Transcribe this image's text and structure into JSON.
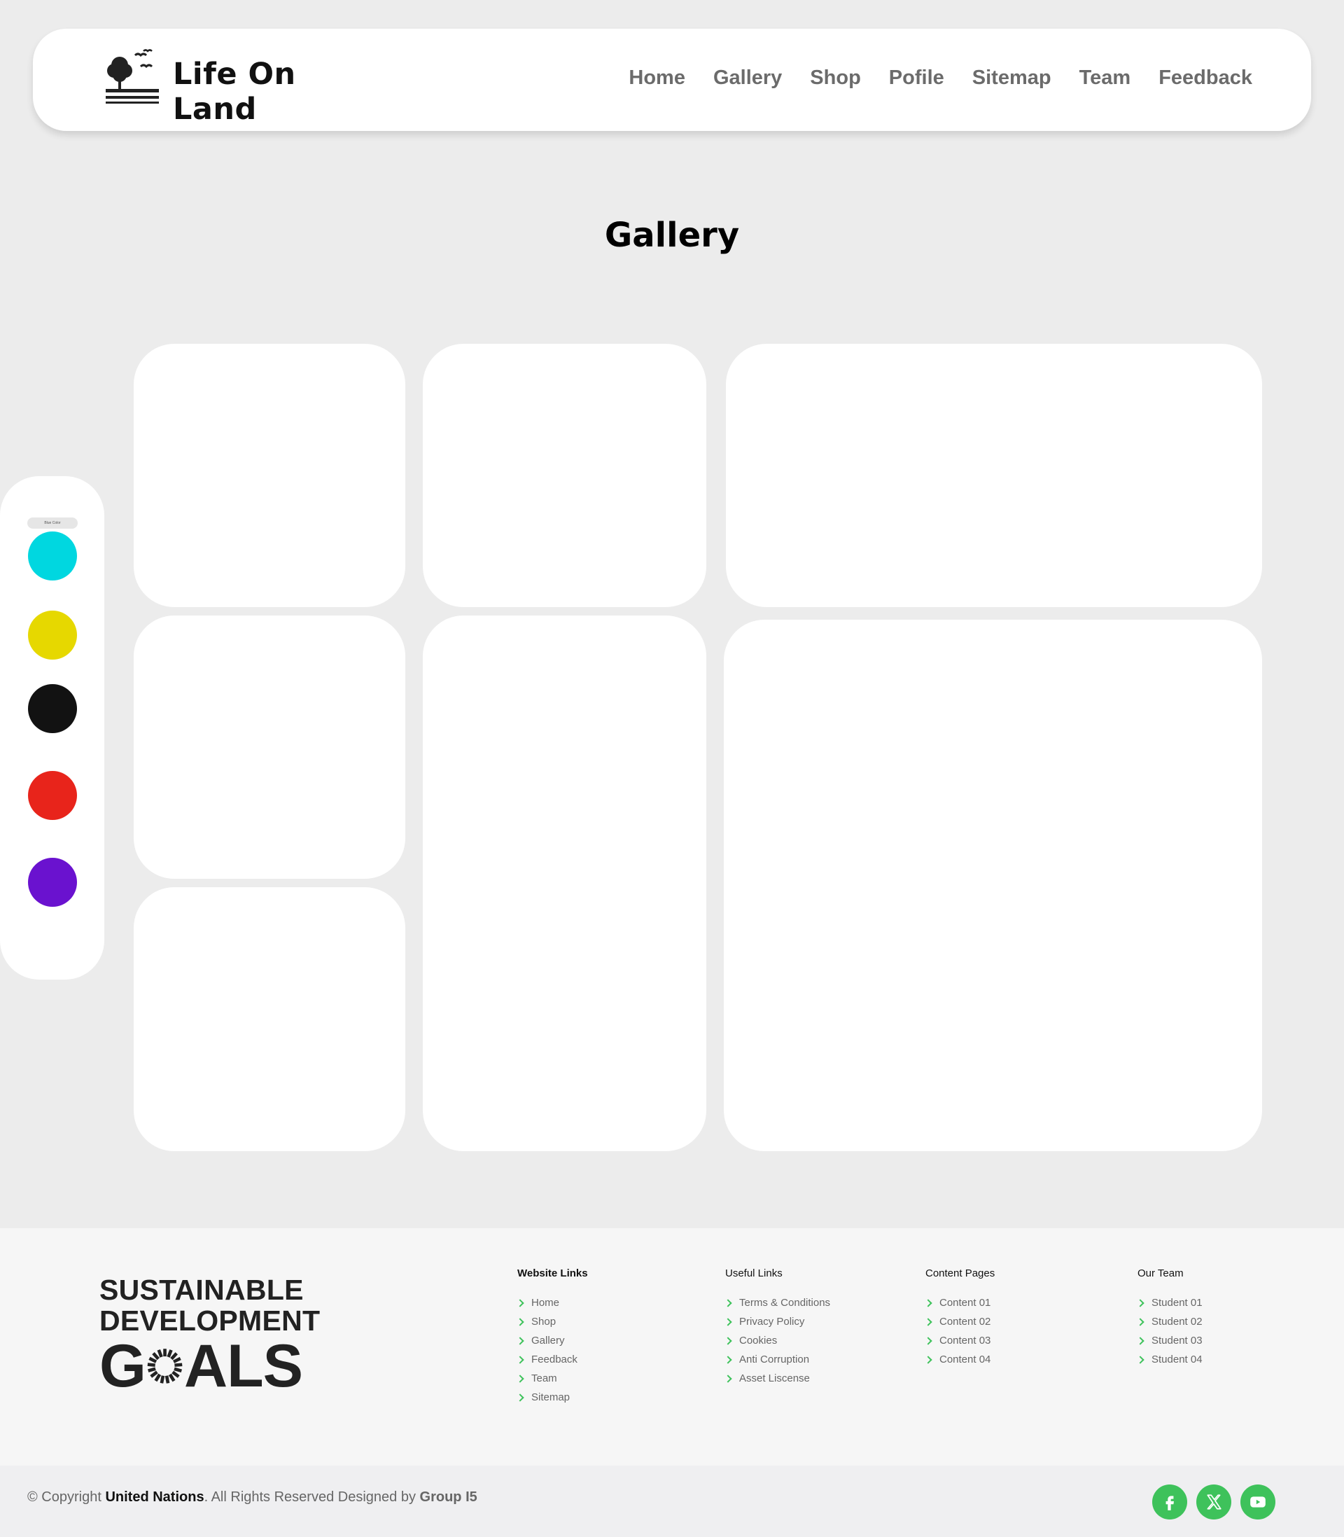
{
  "brand": {
    "name": "Life On Land"
  },
  "nav": {
    "items": [
      "Home",
      "Gallery",
      "Shop",
      "Pofile",
      "Sitemap",
      "Team",
      "Feedback"
    ]
  },
  "page": {
    "title": "Gallery"
  },
  "color_panel": {
    "label": "Blue Color",
    "swatches": [
      "#00d7e0",
      "#e6d800",
      "#121212",
      "#e8241b",
      "#6a12cf"
    ]
  },
  "footer": {
    "logo": {
      "line1": "SUSTAINABLE",
      "line2": "DEVELOPMENT",
      "line3_a": "G",
      "line3_b": "ALS"
    },
    "columns": [
      {
        "title": "Website Links",
        "items": [
          "Home",
          "Shop",
          "Gallery",
          "Feedback",
          "Team",
          "Sitemap"
        ]
      },
      {
        "title": "Useful Links",
        "items": [
          "Terms & Conditions",
          "Privacy Policy",
          "Cookies",
          "Anti Corruption",
          "Asset Liscense"
        ]
      },
      {
        "title": "Content Pages",
        "items": [
          "Content 01",
          "Content 02",
          "Content 03",
          "Content 04"
        ]
      },
      {
        "title": "Our Team",
        "items": [
          "Student 01",
          "Student 02",
          "Student 03",
          "Student 04"
        ]
      }
    ]
  },
  "bottom": {
    "copyright_prefix": "© Copyright ",
    "org": "United Nations",
    "middle": ". All Rights Reserved Designed by ",
    "group": "Group I5",
    "socials": [
      "facebook-icon",
      "x-icon",
      "youtube-icon"
    ]
  },
  "colors": {
    "accent": "#3ec25b",
    "nav_text": "#6b6b6b",
    "background": "#ececec"
  }
}
